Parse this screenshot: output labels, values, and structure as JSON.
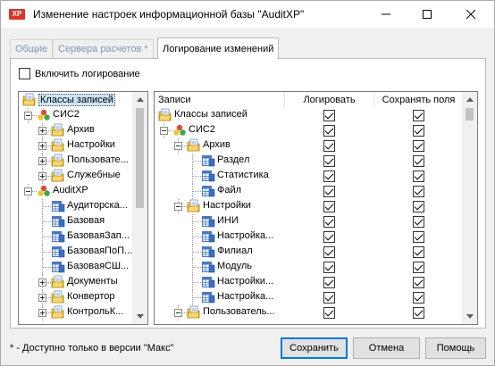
{
  "window": {
    "title": "Изменение настроек информационной базы \"AuditXP\"",
    "icon_text": "XP"
  },
  "tabs": [
    {
      "label": "Общие",
      "active": false
    },
    {
      "label": "Сервера расчетов *",
      "active": false
    },
    {
      "label": "Логирование изменений",
      "active": true
    }
  ],
  "enable_logging": {
    "label": "Включить логирование",
    "checked": false
  },
  "left_tree": {
    "items": [
      {
        "label": "Классы записей",
        "icon": "class-folder-icon",
        "level": 0,
        "expander": "none",
        "selected": true
      },
      {
        "label": "СИС2",
        "icon": "database-cube-icon",
        "level": 1,
        "expander": "minus"
      },
      {
        "label": "Архив",
        "icon": "class-folder-icon",
        "level": 2,
        "expander": "plus"
      },
      {
        "label": "Настройки",
        "icon": "class-folder-icon",
        "level": 2,
        "expander": "plus"
      },
      {
        "label": "Пользовате...",
        "icon": "class-folder-icon",
        "level": 2,
        "expander": "plus"
      },
      {
        "label": "Служебные",
        "icon": "class-folder-icon",
        "level": 2,
        "expander": "plus"
      },
      {
        "label": "AuditXP",
        "icon": "database-cube-icon",
        "level": 1,
        "expander": "minus"
      },
      {
        "label": "Аудиторска...",
        "icon": "table-icon",
        "level": 2,
        "expander": "none"
      },
      {
        "label": "Базовая",
        "icon": "table-icon",
        "level": 2,
        "expander": "none"
      },
      {
        "label": "БазоваяЗап...",
        "icon": "table-icon",
        "level": 2,
        "expander": "none"
      },
      {
        "label": "БазоваяПоП...",
        "icon": "table-icon",
        "level": 2,
        "expander": "none"
      },
      {
        "label": "БазоваяСШ...",
        "icon": "table-icon",
        "level": 2,
        "expander": "none"
      },
      {
        "label": "Документы",
        "icon": "class-folder-icon",
        "level": 2,
        "expander": "plus"
      },
      {
        "label": "Конвертор",
        "icon": "class-folder-icon",
        "level": 2,
        "expander": "plus"
      },
      {
        "label": "КонтрольК...",
        "icon": "class-folder-icon",
        "level": 2,
        "expander": "plus"
      }
    ]
  },
  "right_table": {
    "columns": [
      "Записи",
      "Логировать",
      "Сохранять поля"
    ],
    "rows": [
      {
        "label": "Классы записей",
        "icon": "class-folder-icon",
        "level": 0,
        "expander": "none",
        "log": true,
        "save": true
      },
      {
        "label": "СИС2",
        "icon": "database-cube-icon",
        "level": 1,
        "expander": "minus",
        "log": true,
        "save": true
      },
      {
        "label": "Архив",
        "icon": "class-folder-icon",
        "level": 2,
        "expander": "minus",
        "log": true,
        "save": true
      },
      {
        "label": "Раздел",
        "icon": "table-icon",
        "level": 3,
        "expander": "none",
        "log": true,
        "save": true
      },
      {
        "label": "Статистика",
        "icon": "table-icon",
        "level": 3,
        "expander": "none",
        "log": true,
        "save": true
      },
      {
        "label": "Файл",
        "icon": "table-icon",
        "level": 3,
        "expander": "none",
        "log": true,
        "save": true
      },
      {
        "label": "Настройки",
        "icon": "class-folder-icon",
        "level": 2,
        "expander": "minus",
        "log": true,
        "save": true
      },
      {
        "label": "ИНИ",
        "icon": "table-icon",
        "level": 3,
        "expander": "none",
        "log": true,
        "save": true
      },
      {
        "label": "Настройка...",
        "icon": "table-icon",
        "level": 3,
        "expander": "none",
        "log": true,
        "save": true
      },
      {
        "label": "Филиал",
        "icon": "table-icon",
        "level": 3,
        "expander": "none",
        "log": true,
        "save": true
      },
      {
        "label": "Модуль",
        "icon": "table-icon",
        "level": 3,
        "expander": "none",
        "log": true,
        "save": true
      },
      {
        "label": "Настройки...",
        "icon": "table-icon",
        "level": 3,
        "expander": "none",
        "log": true,
        "save": true
      },
      {
        "label": "Настройка...",
        "icon": "table-icon",
        "level": 3,
        "expander": "none",
        "log": true,
        "save": true
      },
      {
        "label": "Пользователь...",
        "icon": "class-folder-icon",
        "level": 2,
        "expander": "minus",
        "log": true,
        "save": true
      }
    ]
  },
  "footnote": "* - Доступно только в версии \"Макс\"",
  "buttons": {
    "save": "Сохранить",
    "cancel": "Отмена",
    "help": "Помощь"
  },
  "colors": {
    "accent": "#0078d7",
    "selection": "#cce4f7",
    "inactive_tab_text": "#7d96b8"
  }
}
